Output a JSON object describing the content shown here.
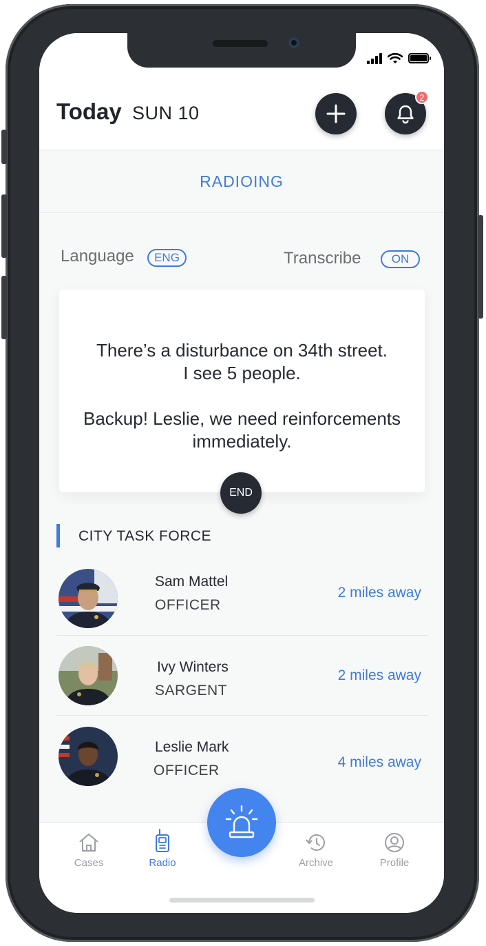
{
  "status_bar": {
    "signal_icon": "signal-icon",
    "wifi_icon": "wifi-icon",
    "battery_icon": "battery-icon"
  },
  "header": {
    "title": "Today",
    "date": "SUN 10",
    "add_icon": "plus-icon",
    "bell_icon": "bell-icon",
    "notification_count": "2"
  },
  "tab": {
    "label": "RADIOING"
  },
  "settings": {
    "language_label": "Language",
    "language_value": "ENG",
    "transcribe_label": "Transcribe",
    "transcribe_value": "ON"
  },
  "transcript": {
    "line1": "There’s a disturbance on 34th street.",
    "line2": "I see 5 people.",
    "line3": "Backup! Leslie, we need reinforcements",
    "line4": "immediately."
  },
  "end_button": {
    "label": "END"
  },
  "section": {
    "title": "CITY TASK FORCE"
  },
  "contacts": [
    {
      "name": "Sam Mattel",
      "role": "OFFICER",
      "distance": "2 miles away"
    },
    {
      "name": "Ivy Winters",
      "role": "SARGENT",
      "distance": "2 miles away"
    },
    {
      "name": "Leslie Mark",
      "role": "OFFICER",
      "distance": "4 miles away"
    }
  ],
  "nav": {
    "items": [
      {
        "label": "Cases",
        "icon": "home-icon"
      },
      {
        "label": "Radio",
        "icon": "walkie-talkie-icon"
      },
      {
        "label": "Archive",
        "icon": "history-icon"
      },
      {
        "label": "Profile",
        "icon": "user-icon"
      }
    ],
    "center_icon": "siren-icon"
  },
  "colors": {
    "accent": "#3d7be0",
    "dark": "#252a33",
    "badge": "#f36a6a"
  }
}
